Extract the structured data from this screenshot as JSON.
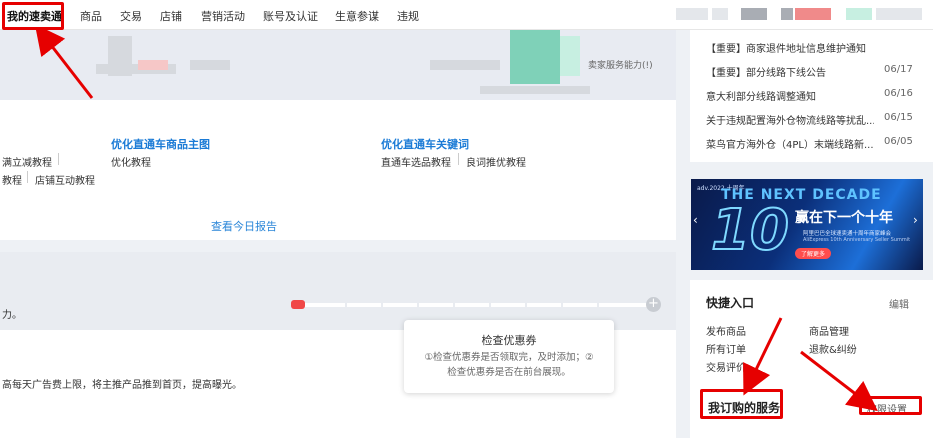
{
  "nav": {
    "items": [
      "我的速卖通",
      "商品",
      "交易",
      "店铺",
      "营销活动",
      "账号及认证",
      "生意参谋",
      "违规"
    ]
  },
  "banner_top": {
    "text": "卖家服务能力(!)"
  },
  "optimize": {
    "col1": {
      "row1": "满立减教程",
      "row2_a": "教程",
      "row2_b": "店铺互动教程"
    },
    "col2": {
      "title": "优化直通车商品主图",
      "link": "优化教程"
    },
    "col3": {
      "title": "优化直通车关键词",
      "link_a": "直通车选品教程",
      "link_b": "良词推优教程"
    },
    "view_report": "查看今日报告"
  },
  "capacity": {
    "left_text": "力。",
    "progress_level": 0.04
  },
  "tooltip": {
    "title": "检查优惠券",
    "line1": "①检查优惠券是否领取完，及时添加；②",
    "line2": "检查优惠券是否在前台展现。"
  },
  "tip_text": "高每天广告费上限，将主推产品推到首页，提高曝光。",
  "notices": [
    {
      "text": "【重要】商家退件地址信息维护通知",
      "date": ""
    },
    {
      "text": "【重要】部分线路下线公告",
      "date": "06/17"
    },
    {
      "text": "意大利部分线路调整通知",
      "date": "06/16"
    },
    {
      "text": "关于违规配置海外仓物流线路等扰乱...",
      "date": "06/15"
    },
    {
      "text": "菜鸟官方海外仓（4PL）末端线路新...",
      "date": "06/05"
    }
  ],
  "ad": {
    "top_left": "adv.2022 十周年",
    "headline": "赢在下一个十年",
    "sub1": "阿里巴巴全球速卖通十周年商家峰会",
    "sub2": "AliExpress 10th Anniversary Seller Summit",
    "en_big": "THE NEXT DECADE",
    "button": "了解更多"
  },
  "quick": {
    "title": "快捷入口",
    "edit": "编辑",
    "links": [
      "发布商品",
      "商品管理",
      "所有订单",
      "退款&纠纷",
      "交易评价"
    ],
    "services_title": "我订购的服务",
    "permission": "权限设置"
  },
  "colors": {
    "accent": "#1b7bd6",
    "annotation_red": "#e60000"
  }
}
